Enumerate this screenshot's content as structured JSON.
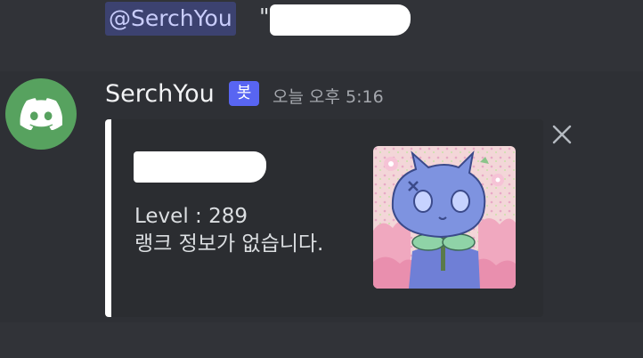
{
  "reply": {
    "mention": "@SerchYou",
    "quote_open": "\""
  },
  "message": {
    "avatar_icon": "discord-logo-icon",
    "avatar_color": "#57a25f",
    "username": "SerchYou",
    "bot_badge": "봇",
    "timestamp": "오늘 오후 5:16"
  },
  "embed": {
    "accent_color": "#ffffff",
    "level_text": "Level : 289",
    "rank_text": "랭크 정보가 없습니다.",
    "thumbnail_icon": "blue-cat-character-image"
  },
  "actions": {
    "close_icon": "close-icon"
  },
  "colors": {
    "background": "#313338",
    "message_highlight": "#2e3035",
    "embed_background": "#2b2d31",
    "mention_background": "#3c4270",
    "mention_text": "#c9cdfb",
    "bot_badge": "#5865f2"
  }
}
